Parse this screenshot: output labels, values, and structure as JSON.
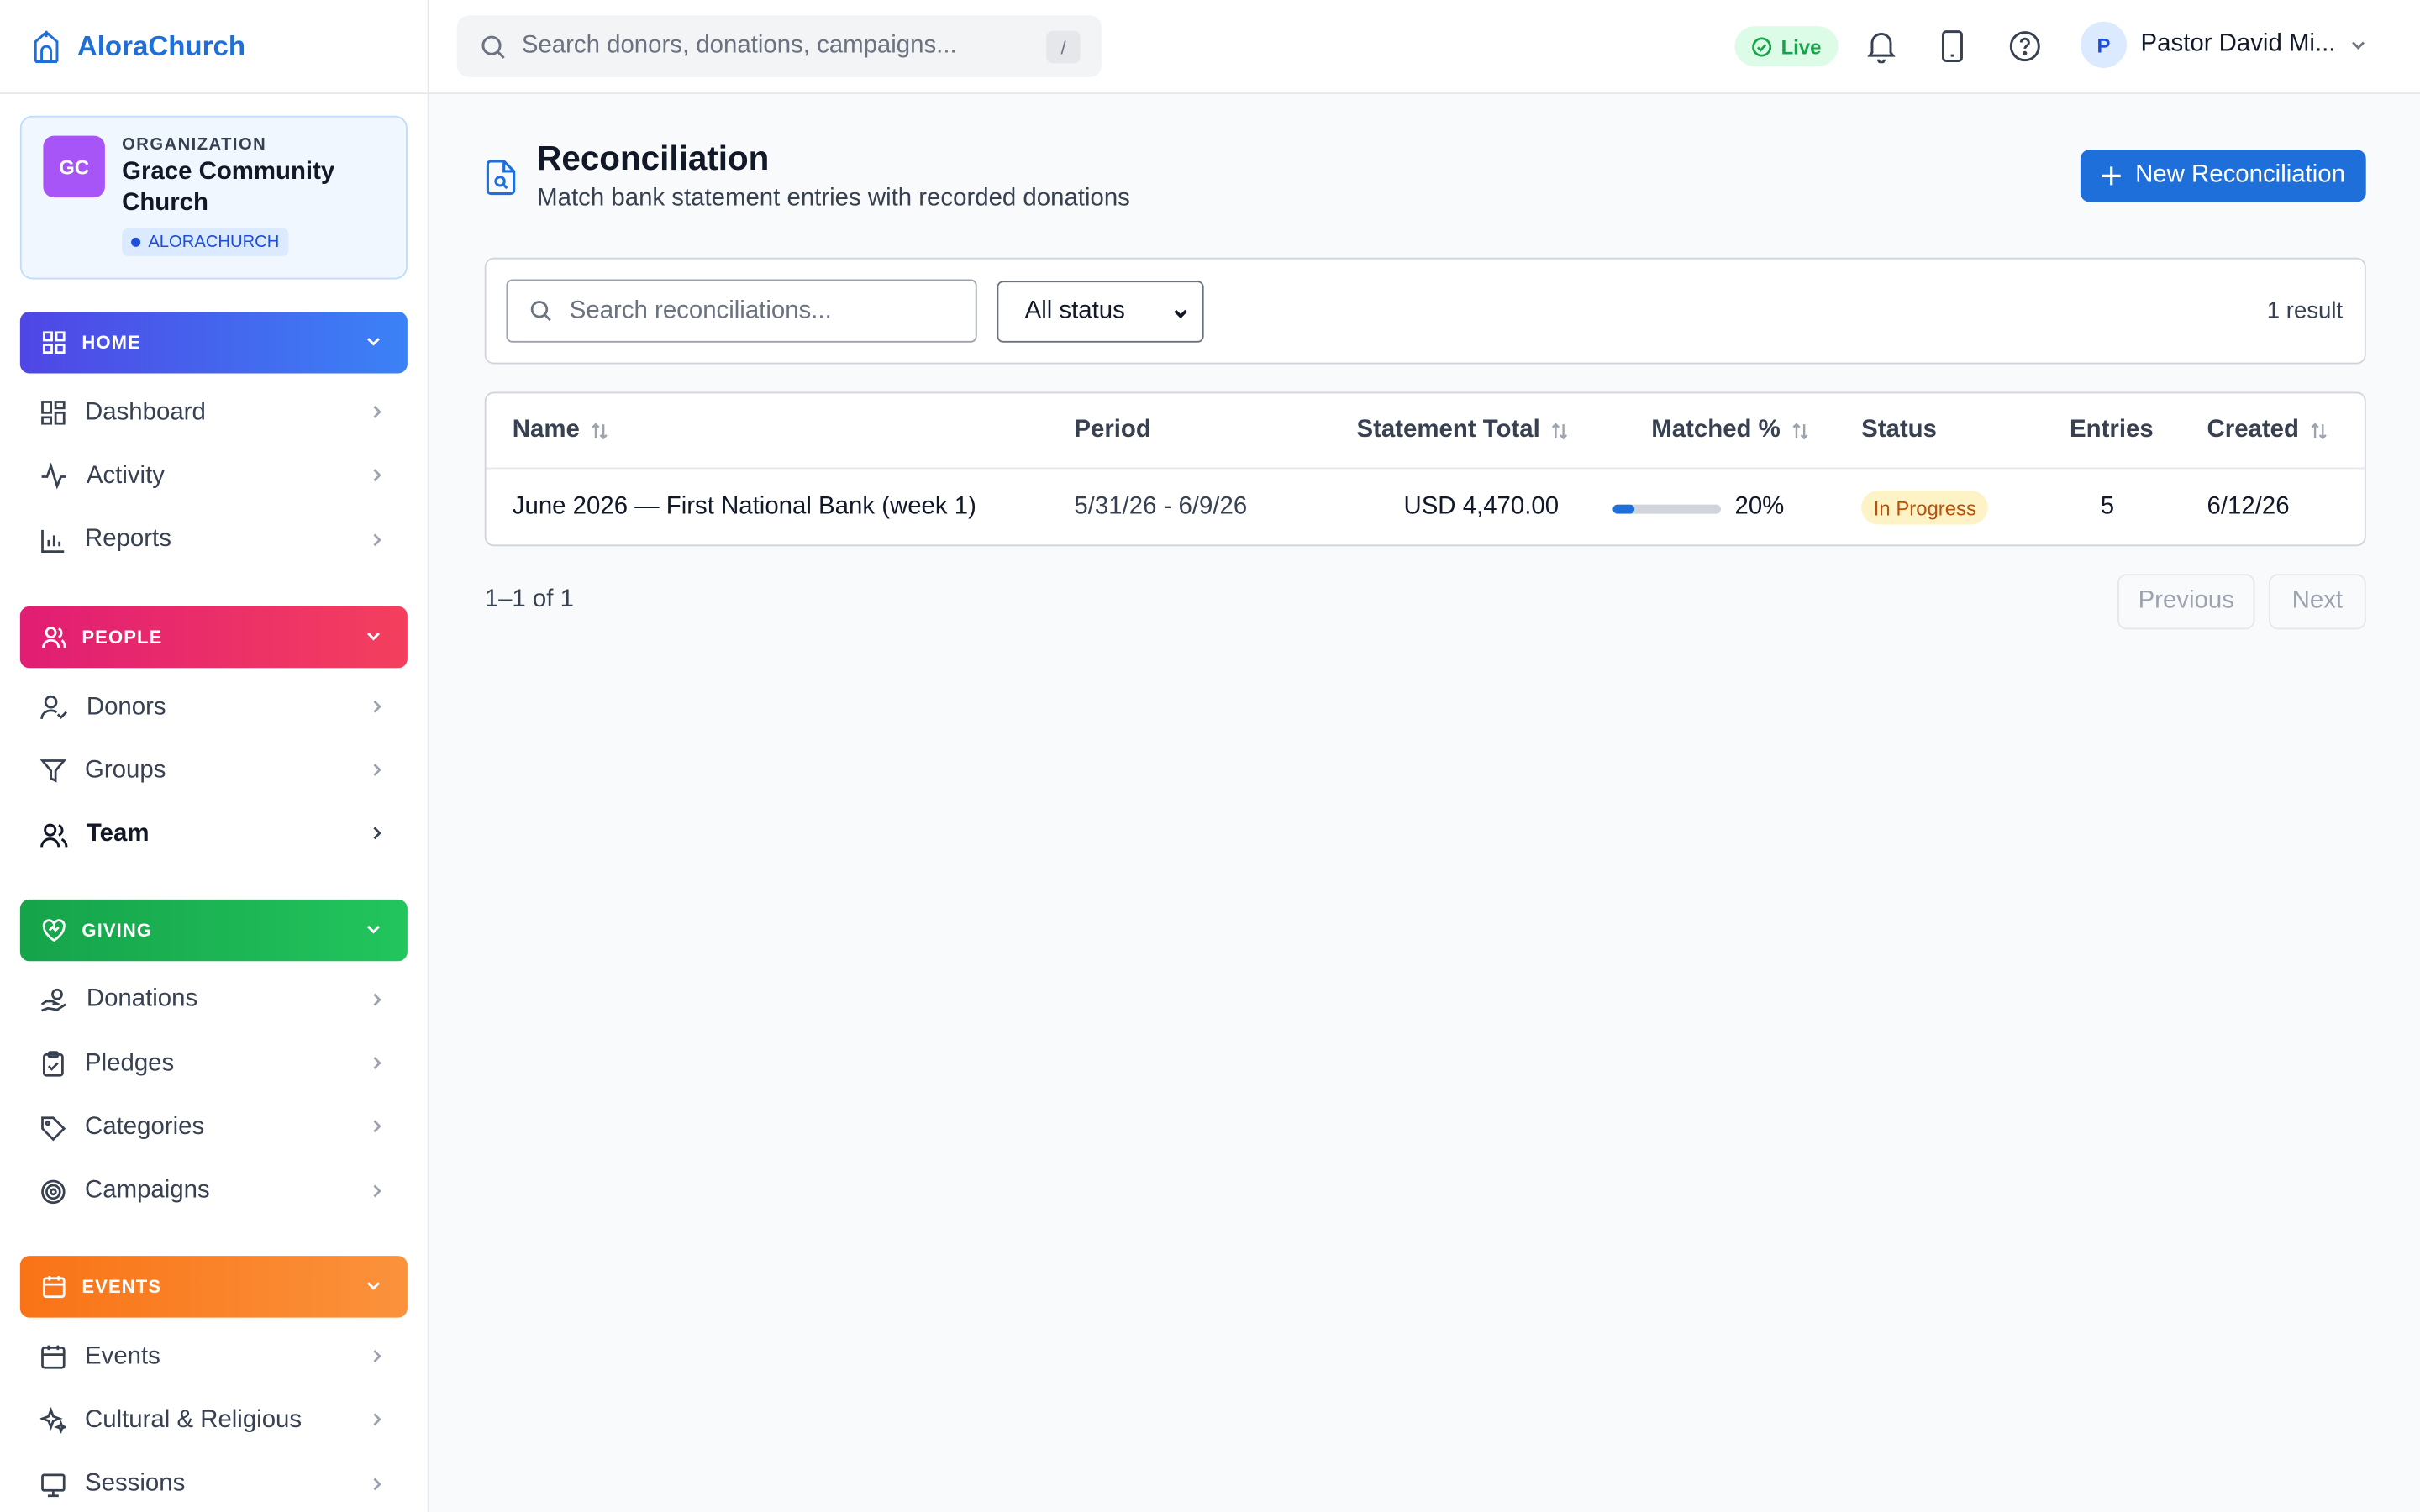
{
  "brand": {
    "name": "AloraChurch"
  },
  "org": {
    "initials": "GC",
    "label": "ORGANIZATION",
    "name": "Grace Community Church",
    "badge": "ALORACHURCH"
  },
  "sidebar": {
    "sections": [
      {
        "key": "home",
        "title": "HOME",
        "icon": "grid-icon",
        "items": [
          {
            "label": "Dashboard",
            "icon": "dashboard-icon"
          },
          {
            "label": "Activity",
            "icon": "activity-icon"
          },
          {
            "label": "Reports",
            "icon": "bar-chart-icon"
          }
        ]
      },
      {
        "key": "people",
        "title": "PEOPLE",
        "icon": "users-icon",
        "items": [
          {
            "label": "Donors",
            "icon": "user-check-icon"
          },
          {
            "label": "Groups",
            "icon": "filter-icon"
          },
          {
            "label": "Team",
            "icon": "team-icon",
            "active": true
          }
        ]
      },
      {
        "key": "giving",
        "title": "GIVING",
        "icon": "heart-handshake-icon",
        "items": [
          {
            "label": "Donations",
            "icon": "hand-coins-icon"
          },
          {
            "label": "Pledges",
            "icon": "clipboard-check-icon"
          },
          {
            "label": "Categories",
            "icon": "tag-icon"
          },
          {
            "label": "Campaigns",
            "icon": "target-icon"
          }
        ]
      },
      {
        "key": "events",
        "title": "EVENTS",
        "icon": "calendar-icon",
        "items": [
          {
            "label": "Events",
            "icon": "calendar-icon"
          },
          {
            "label": "Cultural & Religious",
            "icon": "sparkles-icon"
          },
          {
            "label": "Sessions",
            "icon": "monitor-icon"
          }
        ]
      }
    ]
  },
  "topbar": {
    "search_placeholder": "Search donors, donations, campaigns...",
    "search_shortcut": "/",
    "live_label": "Live",
    "user_initial": "P",
    "user_name": "Pastor David Mi..."
  },
  "page": {
    "title": "Reconciliation",
    "subtitle": "Match bank statement entries with recorded donations",
    "new_button": "New Reconciliation"
  },
  "filters": {
    "search_placeholder": "Search reconciliations...",
    "status_value": "All status",
    "result_count": "1 result"
  },
  "table": {
    "headers": {
      "name": "Name",
      "period": "Period",
      "statement_total": "Statement Total",
      "matched": "Matched %",
      "status": "Status",
      "entries": "Entries",
      "created": "Created"
    },
    "rows": [
      {
        "name": "June 2026 — First National Bank (week 1)",
        "period": "5/31/26 - 6/9/26",
        "statement_total": "USD 4,470.00",
        "matched_pct": 20,
        "matched_label": "20%",
        "status": "In Progress",
        "entries": "5",
        "created": "6/12/26"
      }
    ]
  },
  "pagination": {
    "range": "1–1 of 1",
    "previous": "Previous",
    "next": "Next"
  },
  "colors": {
    "accent": "#1e6fd9",
    "home": "#4f46e5",
    "people": "#e11d74",
    "giving": "#16a34a",
    "events": "#f97316",
    "status_in_progress_bg": "#fef3c7",
    "status_in_progress_fg": "#b45309"
  }
}
